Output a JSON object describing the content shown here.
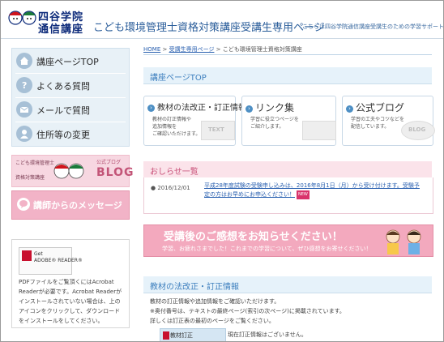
{
  "header": {
    "logo_line1": "四谷学院",
    "logo_line2": "通信講座",
    "site_title": "こども環境管理士資格対策講座受講生専用ページ",
    "note": "こちらは四谷学院通信講座受講生のための学習サポートページです。"
  },
  "sidebar": {
    "nav": [
      {
        "label": "講座ページTOP"
      },
      {
        "label": "よくある質問"
      },
      {
        "label": "メールで質問"
      },
      {
        "label": "住所等の変更"
      }
    ],
    "blog_banner": {
      "tag1": "こども環境管理士",
      "tag2": "資格対策講座",
      "small": "公式ブログ",
      "big": "BLOG"
    },
    "message_banner": {
      "label": "講師からのメッセージ"
    },
    "adobe": {
      "get": "Get",
      "name": "ADOBE® READER®",
      "note": "PDFファイルをご覧頂くにはAcrobat Readerが必要です。Acrobat Readerがインストールされていない場合は、上のアイコンをクリックして、ダウンロードをインストールをしてください。"
    }
  },
  "breadcrumb": {
    "home": "HOME",
    "sep": " > ",
    "mid": "受講生専用ページ",
    "current": "こども環境管理士資格対策講座"
  },
  "main": {
    "heading": "講座ページTOP",
    "boxes": [
      {
        "title": "教材の法改正・訂正情報",
        "body": [
          "教材の訂正情報や",
          "追加情報を",
          "ご確認いただけます。"
        ],
        "deco": "TEXT"
      },
      {
        "title": "リンク集",
        "body": [
          "学習に役立つページを",
          "ご紹介します。"
        ],
        "deco": ""
      },
      {
        "title": "公式ブログ",
        "body": [
          "学習の工夫やコツなどを",
          "配信しています。"
        ],
        "deco": "BLOG"
      }
    ],
    "news": {
      "heading": "おしらせ一覧",
      "items": [
        {
          "date": "● 2016/12/01",
          "text": "平成28年度試験の受験申し込みは、2016年8月1日（月）から受け付けます。受験予定の方はお早めにお申込ください！",
          "badge": "NEW"
        }
      ]
    },
    "impression": {
      "title": "受講後のご感想をお知らせください！",
      "sub": "学習、お疲れさまでした！これまでの学習について、ぜひ感想をお寄せください！"
    },
    "revision": {
      "heading": "教材の法改正・訂正情報",
      "lines": [
        "教材の訂正情報や追加情報をご確認いただけます。",
        "※奥付番号は、テキストの最終ページ(索引の次ページ)に掲載されています。",
        "詳しくは訂正表の最初のページをご覧ください。"
      ],
      "table_label": "教材訂正",
      "table_value": "現在訂正情報はございません。"
    }
  },
  "colors": {
    "accent_blue": "#3d7fbe",
    "pink": "#f3a9be",
    "nav_bg": "#e8f1f7"
  }
}
